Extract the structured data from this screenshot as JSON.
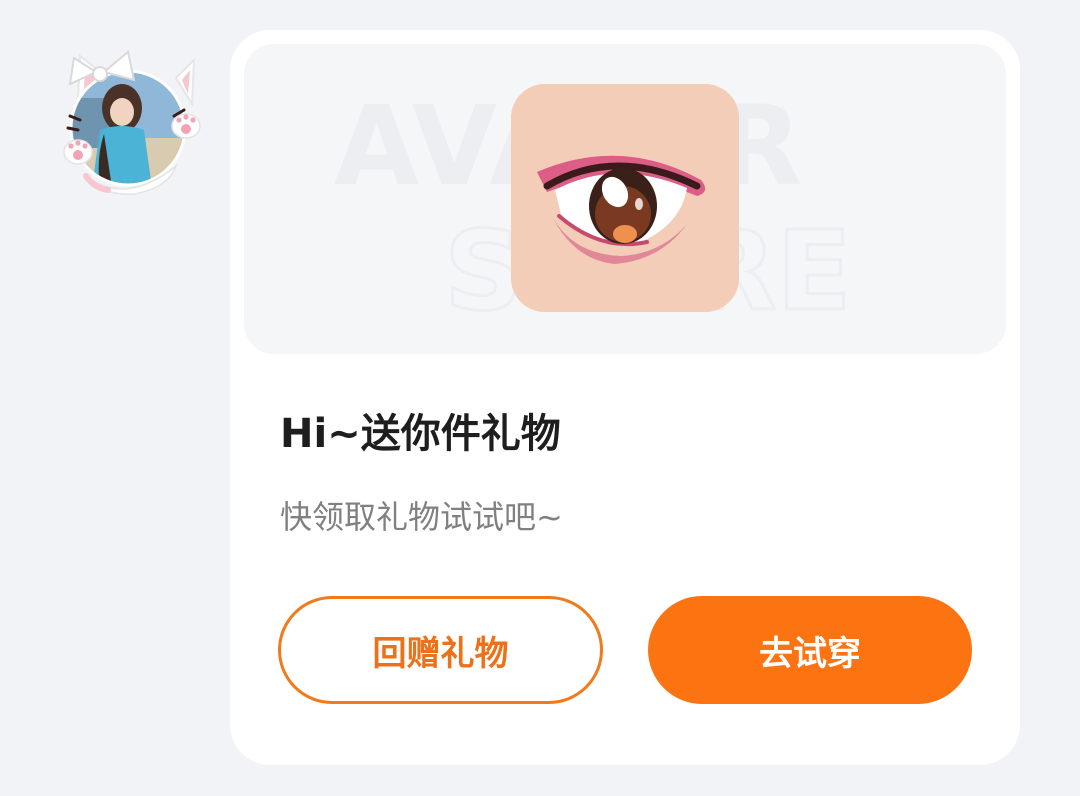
{
  "sender": {
    "avatar_icon": "cat-ear-avatar-frame"
  },
  "gift_card": {
    "preview": {
      "watermark_line1": "AVATAR",
      "watermark_line2": "STORE",
      "item_icon": "anime-eye-icon"
    },
    "title": "Hi~送你件礼物",
    "subtitle": "快领取礼物试试吧~",
    "buttons": {
      "return_gift": "回赠礼物",
      "try_on": "去试穿"
    }
  },
  "colors": {
    "accent": "#fb7411",
    "outline_button": "#f07a1c",
    "background": "#f2f3f6",
    "card": "#ffffff"
  }
}
